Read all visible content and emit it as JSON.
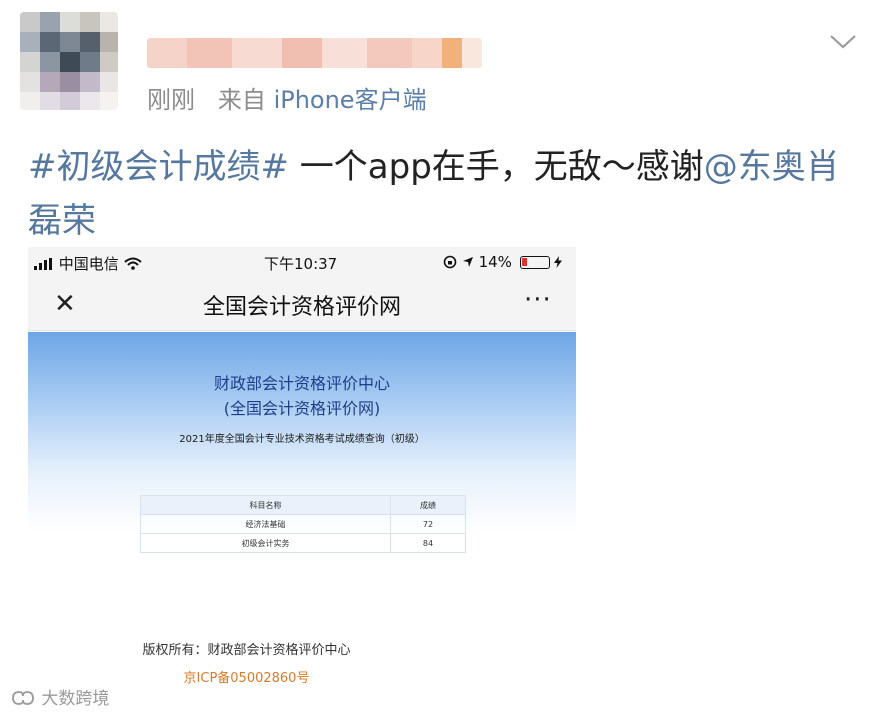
{
  "post_header": {
    "meta_time": "刚刚",
    "meta_from": "来自",
    "meta_source": "iPhone客户端"
  },
  "post": {
    "hashtag": "#初级会计成绩#",
    "body": " 一个app在手，无敌～感谢",
    "mention": "@东奥肖磊荣"
  },
  "screenshot": {
    "status": {
      "carrier": "中国电信",
      "time": "下午10:37",
      "battery_text": "14%"
    },
    "nav": {
      "close_glyph": "✕",
      "title": "全国会计资格评价网",
      "more_glyph": "···"
    },
    "site": {
      "org_line1": "财政部会计资格评价中心",
      "org_line2": "(全国会计资格评价网)",
      "query_title": "2021年度全国会计专业技术资格考试成绩查询（初级）"
    },
    "table": {
      "headers": [
        "科目名称",
        "成绩"
      ],
      "rows": [
        {
          "subject": "经济法基础",
          "score": "72"
        },
        {
          "subject": "初级会计实务",
          "score": "84"
        }
      ]
    },
    "footer": {
      "copyright": "版权所有：财政部会计资格评价中心",
      "icp": "京ICP备05002860号"
    }
  },
  "watermark": "大数跨境",
  "colors": {
    "link_blue": "#56789e",
    "meta_gray": "#8c8c8c",
    "banner_blue": "#6da6e6",
    "icp_orange": "#d77a2c",
    "battery_red": "#e0322f"
  },
  "icons": {
    "chevron": "chevron-down-icon",
    "signal": "signal-bars-icon",
    "wifi": "wifi-icon",
    "lock": "orientation-lock-icon",
    "location": "location-arrow-icon",
    "battery": "battery-icon",
    "charging": "charging-bolt-icon"
  }
}
